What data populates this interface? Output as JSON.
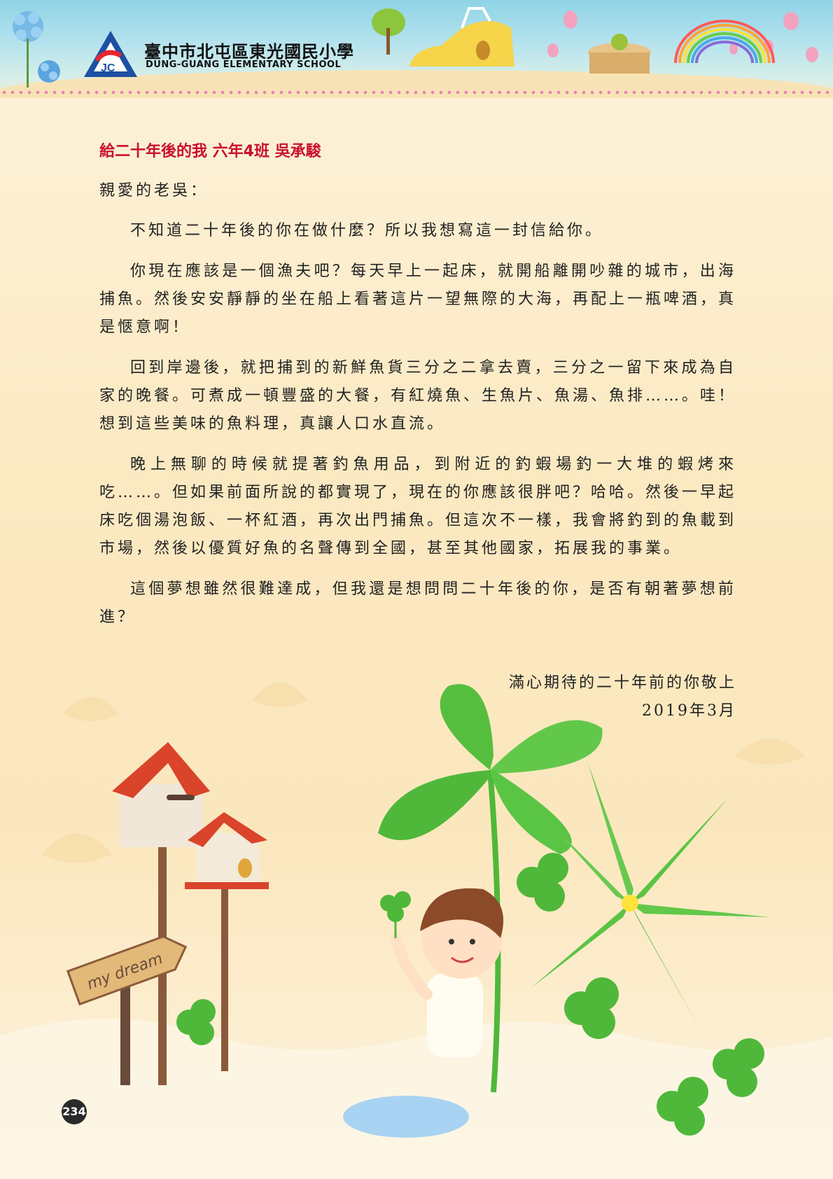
{
  "header": {
    "school_name_cn": "臺中市北屯區東光國民小學",
    "school_name_en": "DUNG-GUANG ELEMENTARY SCHOOL",
    "logo_icon": "school-logo-icon"
  },
  "letter": {
    "title": "給二十年後的我 六年4班 吳承駿",
    "salutation": "親愛的老吳：",
    "paragraphs": [
      "不知道二十年後的你在做什麼？所以我想寫這一封信給你。",
      "你現在應該是一個漁夫吧？每天早上一起床，就開船離開吵雜的城市，出海捕魚。然後安安靜靜的坐在船上看著這片一望無際的大海，再配上一瓶啤酒，真是愜意啊！",
      "回到岸邊後，就把捕到的新鮮魚貨三分之二拿去賣，三分之一留下來成為自家的晚餐。可煮成一頓豐盛的大餐，有紅燒魚、生魚片、魚湯、魚排……。哇！想到這些美味的魚料理，真讓人口水直流。",
      "晚上無聊的時候就提著釣魚用品，到附近的釣蝦場釣一大堆的蝦烤來吃……。但如果前面所說的都實現了，現在的你應該很胖吧？哈哈。然後一早起床吃個湯泡飯、一杯紅酒，再次出門捕魚。但這次不一樣，我會將釣到的魚載到市場，然後以優質好魚的名聲傳到全國，甚至其他國家，拓展我的事業。",
      "這個夢想雖然很難達成，但我還是想問問二十年後的你，是否有朝著夢想前進？"
    ],
    "signoff": "滿心期待的二十年前的你敬上",
    "date": "2019年3月"
  },
  "illustration": {
    "sign_text": "my dream"
  },
  "page_number": "234",
  "colors": {
    "title_red": "#c8102e",
    "clover_green": "#4fb83a",
    "roof_red": "#d9442b",
    "sky_blue": "#8fd3e6"
  }
}
